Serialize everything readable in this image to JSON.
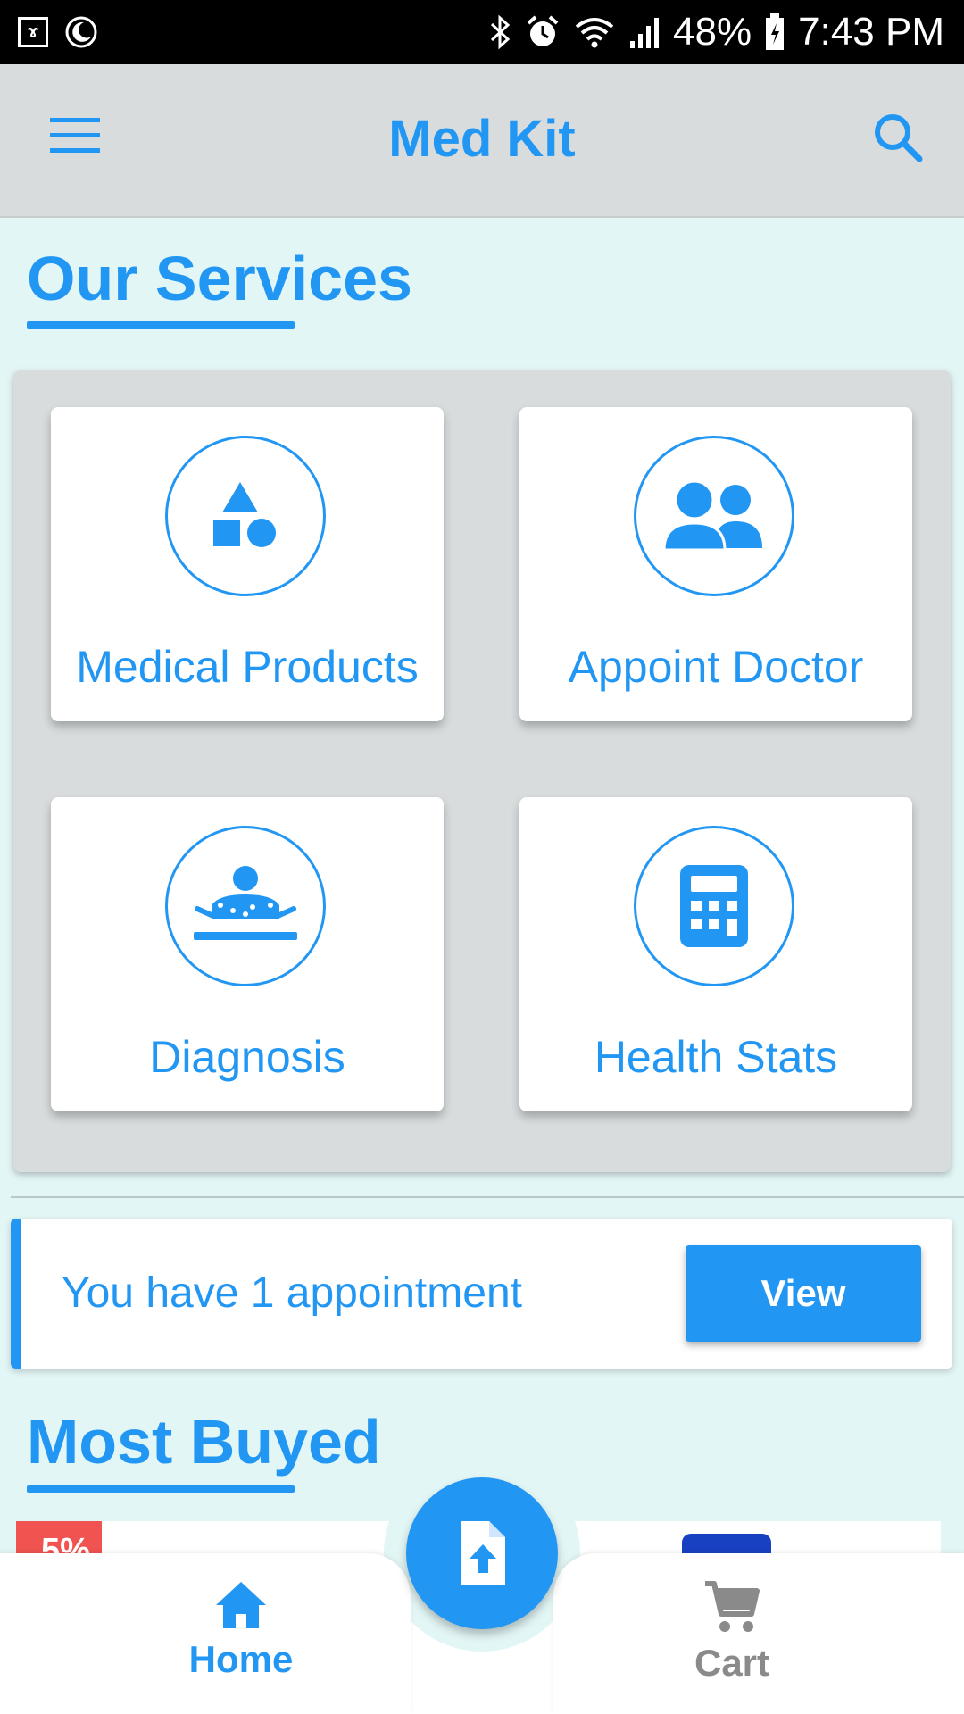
{
  "status_bar": {
    "battery": "48%",
    "time": "7:43 PM"
  },
  "app_bar": {
    "title": "Med Kit"
  },
  "services": {
    "heading": "Our Services",
    "items": [
      {
        "label": "Medical Products",
        "icon": "shapes-icon"
      },
      {
        "label": "Appoint Doctor",
        "icon": "people-icon"
      },
      {
        "label": "Diagnosis",
        "icon": "patient-bed-icon"
      },
      {
        "label": "Health Stats",
        "icon": "calculator-icon"
      }
    ]
  },
  "appointment": {
    "message": "You have 1 appointment",
    "button_label": "View"
  },
  "most_buyed": {
    "heading": "Most Buyed",
    "first_product_discount": "5%"
  },
  "bottom_nav": {
    "home_label": "Home",
    "cart_label": "Cart",
    "fab_icon": "file-upload-icon"
  },
  "colors": {
    "accent": "#2196f3",
    "background": "#e3f6f6",
    "app_bar": "#d8dcdd",
    "inactive_nav": "#8a8a8a",
    "badge": "#f05350"
  }
}
